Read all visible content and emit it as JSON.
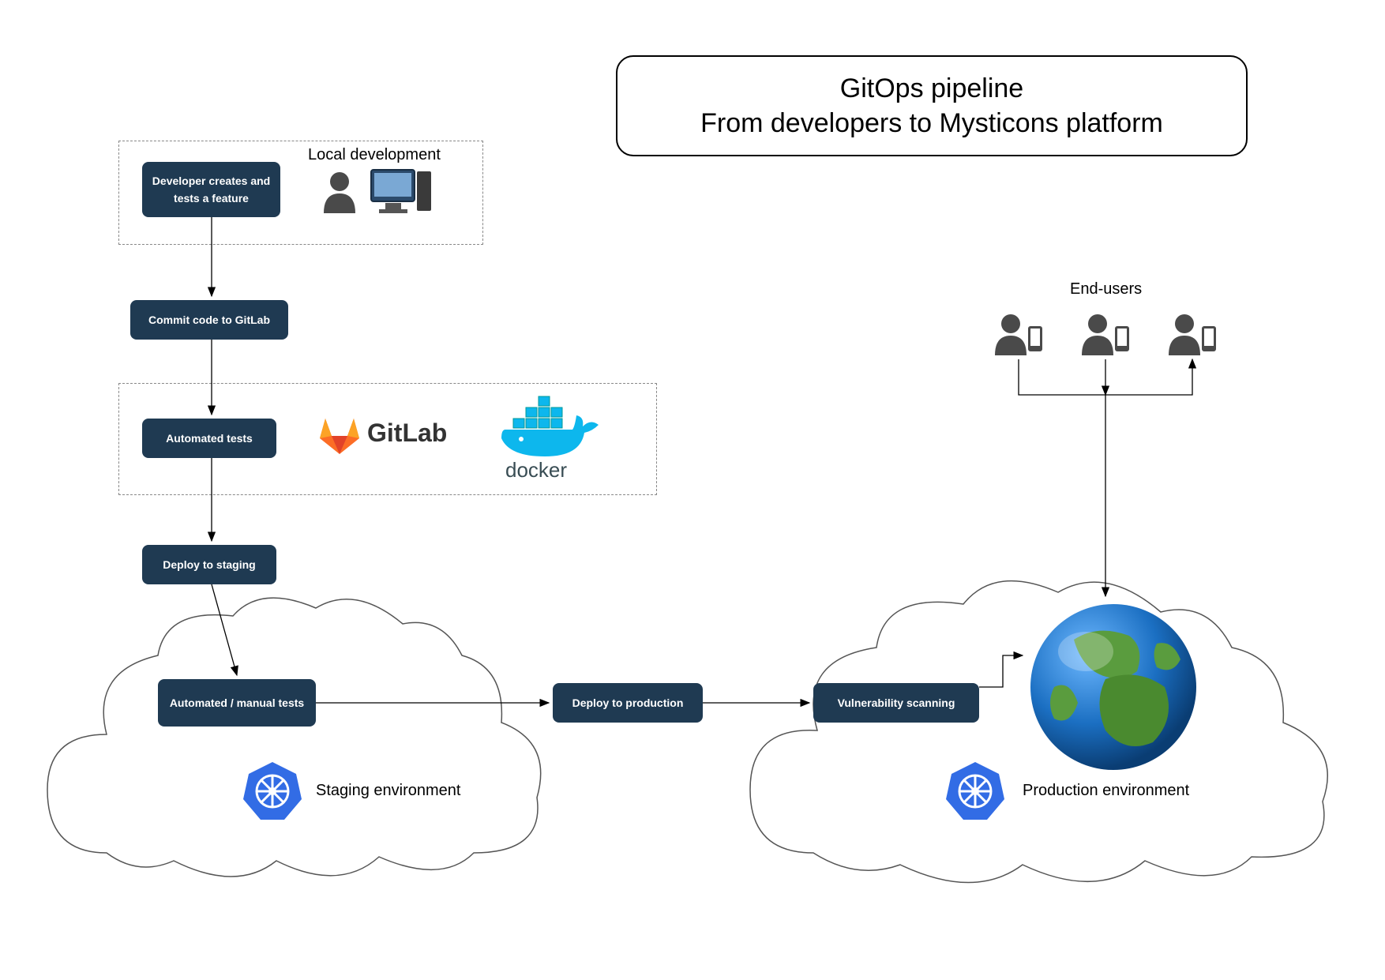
{
  "title": {
    "line1": "GitOps pipeline",
    "line2": "From developers to Mysticons platform"
  },
  "labels": {
    "local_dev": "Local development",
    "end_users": "End-users",
    "staging_env": "Staging environment",
    "production_env": "Production environment",
    "gitlab": "GitLab",
    "docker": "docker"
  },
  "nodes": {
    "dev_feature": "Developer creates and tests a feature",
    "commit": "Commit code to GitLab",
    "auto_tests": "Automated tests",
    "deploy_staging": "Deploy to staging",
    "manual_tests": "Automated / manual tests",
    "deploy_prod": "Deploy to production",
    "vuln_scan": "Vulnerability scanning"
  },
  "colors": {
    "node_bg": "#1f3a52",
    "gitlab_orange": "#fc6d26",
    "docker_blue": "#0db7ed",
    "k8s_blue": "#326ce5",
    "user_grey": "#4a4a4a"
  }
}
